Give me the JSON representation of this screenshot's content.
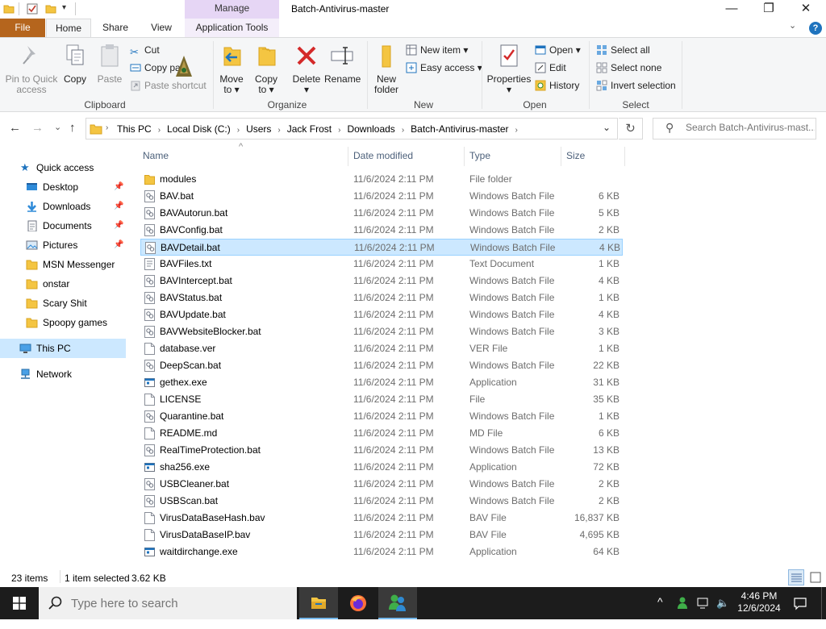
{
  "window": {
    "title": "Batch-Antivirus-master",
    "manage_tab": "Manage",
    "minimize": "—",
    "maximize": "❐",
    "close": "✕"
  },
  "tabs": {
    "file": "File",
    "home": "Home",
    "share": "Share",
    "view": "View",
    "app_tools": "Application Tools",
    "help_icon": "?"
  },
  "ribbon": {
    "clipboard": {
      "label": "Clipboard",
      "pin": "Pin to Quick\naccess",
      "pin_l1": "Pin to Quick",
      "pin_l2": "access",
      "copy": "Copy",
      "paste": "Paste",
      "cut": "Cut",
      "copy_path": "Copy pa",
      "paste_shortcut": "Paste shortcut"
    },
    "organize": {
      "label": "Organize",
      "move_l1": "Move",
      "move_l2": "to ▾",
      "copy_l1": "Copy",
      "copy_l2": "to ▾",
      "delete_l1": "Delete",
      "delete_l2": "▾",
      "rename": "Rename"
    },
    "new": {
      "label": "New",
      "new_folder_l1": "New",
      "new_folder_l2": "folder",
      "new_item": "New item ▾",
      "easy_access": "Easy access ▾"
    },
    "open": {
      "label": "Open",
      "properties_l1": "Properties",
      "properties_l2": "▾",
      "open": "Open ▾",
      "edit": "Edit",
      "history": "History"
    },
    "select": {
      "label": "Select",
      "select_all": "Select all",
      "select_none": "Select none",
      "invert": "Invert selection"
    }
  },
  "address": {
    "back": "←",
    "forward": "→",
    "recent": "⌄",
    "up": "↑",
    "crumbs": [
      "This PC",
      "Local Disk (C:)",
      "Users",
      "Jack Frost",
      "Downloads",
      "Batch-Antivirus-master"
    ],
    "refresh": "↻",
    "dropdown": "⌄",
    "search_placeholder": "Search Batch-Antivirus-mast..."
  },
  "nav": {
    "quick_access": "Quick access",
    "items": [
      {
        "label": "Desktop",
        "pinned": true
      },
      {
        "label": "Downloads",
        "pinned": true
      },
      {
        "label": "Documents",
        "pinned": true
      },
      {
        "label": "Pictures",
        "pinned": true
      },
      {
        "label": "MSN Messenger",
        "pinned": false
      },
      {
        "label": "onstar",
        "pinned": false
      },
      {
        "label": "Scary Shit",
        "pinned": false
      },
      {
        "label": "Spoopy games",
        "pinned": false
      }
    ],
    "this_pc": "This PC",
    "network": "Network"
  },
  "columns": {
    "name": "Name",
    "date": "Date modified",
    "type": "Type",
    "size": "Size"
  },
  "files": [
    {
      "name": "modules",
      "date": "11/6/2024 2:11 PM",
      "type": "File folder",
      "size": "",
      "icon": "folder"
    },
    {
      "name": "BAV.bat",
      "date": "11/6/2024 2:11 PM",
      "type": "Windows Batch File",
      "size": "6 KB",
      "icon": "bat"
    },
    {
      "name": "BAVAutorun.bat",
      "date": "11/6/2024 2:11 PM",
      "type": "Windows Batch File",
      "size": "5 KB",
      "icon": "bat"
    },
    {
      "name": "BAVConfig.bat",
      "date": "11/6/2024 2:11 PM",
      "type": "Windows Batch File",
      "size": "2 KB",
      "icon": "bat"
    },
    {
      "name": "BAVDetail.bat",
      "date": "11/6/2024 2:11 PM",
      "type": "Windows Batch File",
      "size": "4 KB",
      "icon": "bat",
      "selected": true
    },
    {
      "name": "BAVFiles.txt",
      "date": "11/6/2024 2:11 PM",
      "type": "Text Document",
      "size": "1 KB",
      "icon": "txt"
    },
    {
      "name": "BAVIntercept.bat",
      "date": "11/6/2024 2:11 PM",
      "type": "Windows Batch File",
      "size": "4 KB",
      "icon": "bat"
    },
    {
      "name": "BAVStatus.bat",
      "date": "11/6/2024 2:11 PM",
      "type": "Windows Batch File",
      "size": "1 KB",
      "icon": "bat"
    },
    {
      "name": "BAVUpdate.bat",
      "date": "11/6/2024 2:11 PM",
      "type": "Windows Batch File",
      "size": "4 KB",
      "icon": "bat"
    },
    {
      "name": "BAVWebsiteBlocker.bat",
      "date": "11/6/2024 2:11 PM",
      "type": "Windows Batch File",
      "size": "3 KB",
      "icon": "bat"
    },
    {
      "name": "database.ver",
      "date": "11/6/2024 2:11 PM",
      "type": "VER File",
      "size": "1 KB",
      "icon": "file"
    },
    {
      "name": "DeepScan.bat",
      "date": "11/6/2024 2:11 PM",
      "type": "Windows Batch File",
      "size": "22 KB",
      "icon": "bat"
    },
    {
      "name": "gethex.exe",
      "date": "11/6/2024 2:11 PM",
      "type": "Application",
      "size": "31 KB",
      "icon": "exe"
    },
    {
      "name": "LICENSE",
      "date": "11/6/2024 2:11 PM",
      "type": "File",
      "size": "35 KB",
      "icon": "file"
    },
    {
      "name": "Quarantine.bat",
      "date": "11/6/2024 2:11 PM",
      "type": "Windows Batch File",
      "size": "1 KB",
      "icon": "bat"
    },
    {
      "name": "README.md",
      "date": "11/6/2024 2:11 PM",
      "type": "MD File",
      "size": "6 KB",
      "icon": "file"
    },
    {
      "name": "RealTimeProtection.bat",
      "date": "11/6/2024 2:11 PM",
      "type": "Windows Batch File",
      "size": "13 KB",
      "icon": "bat"
    },
    {
      "name": "sha256.exe",
      "date": "11/6/2024 2:11 PM",
      "type": "Application",
      "size": "72 KB",
      "icon": "exe"
    },
    {
      "name": "USBCleaner.bat",
      "date": "11/6/2024 2:11 PM",
      "type": "Windows Batch File",
      "size": "2 KB",
      "icon": "bat"
    },
    {
      "name": "USBScan.bat",
      "date": "11/6/2024 2:11 PM",
      "type": "Windows Batch File",
      "size": "2 KB",
      "icon": "bat"
    },
    {
      "name": "VirusDataBaseHash.bav",
      "date": "11/6/2024 2:11 PM",
      "type": "BAV File",
      "size": "16,837 KB",
      "icon": "file"
    },
    {
      "name": "VirusDataBaseIP.bav",
      "date": "11/6/2024 2:11 PM",
      "type": "BAV File",
      "size": "4,695 KB",
      "icon": "file"
    },
    {
      "name": "waitdirchange.exe",
      "date": "11/6/2024 2:11 PM",
      "type": "Application",
      "size": "64 KB",
      "icon": "exe"
    }
  ],
  "status": {
    "items": "23 items",
    "selected": "1 item selected",
    "size": "3.62 KB"
  },
  "taskbar": {
    "search_placeholder": "Type here to search",
    "time": "4:46 PM",
    "date": "12/6/2024"
  },
  "colors": {
    "accent": "#0078d7",
    "file_tab": "#b5651d",
    "manage": "#e6d6f5",
    "selection": "#cce8ff",
    "folder": "#f4c542"
  }
}
